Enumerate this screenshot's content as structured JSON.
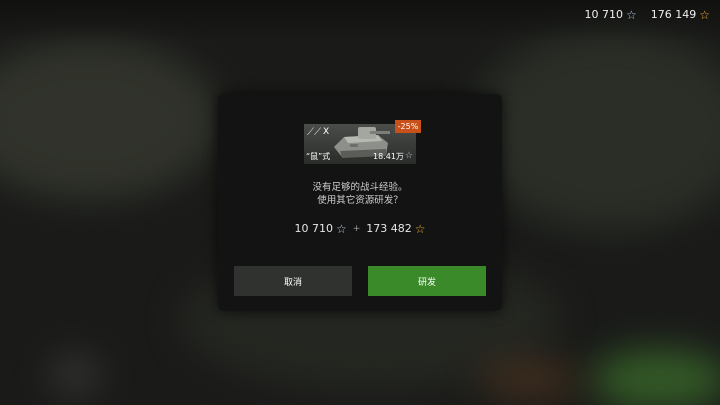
{
  "currency": {
    "silver": "10 710",
    "gold": "176 149",
    "silver_icon": "silver-star-icon",
    "gold_icon": "gold-star-icon"
  },
  "dialog": {
    "vehicle": {
      "tier": "X",
      "name": "“鼠”式",
      "research_cost": "18.41万",
      "discount": "-25%",
      "nation_icon": "nation-emblem-icon"
    },
    "message_line1": "没有足够的战斗经验。",
    "message_line2": "使用其它资源研发？",
    "cost": {
      "silver": "10 710",
      "plus": "+",
      "gold": "173 482"
    },
    "cancel_label": "取消",
    "research_label": "研发"
  },
  "colors": {
    "research_button": "#3a8a2a",
    "discount_badge": "#c8501a",
    "gold": "#f0b030",
    "silver": "#b8cbe0"
  }
}
